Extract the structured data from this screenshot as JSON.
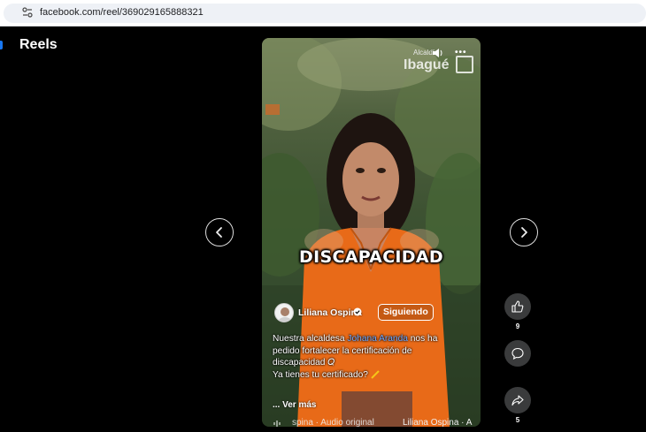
{
  "browser": {
    "url": "facebook.com/reel/369029165888321"
  },
  "page": {
    "title": "Reels"
  },
  "video": {
    "logo_small": "Alcaldía",
    "logo_big": "Ibagué",
    "overlay_text": "DISCAPACIDAD"
  },
  "author": {
    "name": "Liliana Ospina",
    "follow_label": "Siguiendo"
  },
  "caption": {
    "part1": "Nuestra alcaldesa ",
    "mention": "Johana Aranda",
    "part2": " nos ha pedido fortalecer la certificación de discapacidad 𝑄",
    "line2": "Ya tienes tu certificado?",
    "more": "... Ver más"
  },
  "audio": {
    "label": "spina · Audio original",
    "label2": "Liliana Ospina · A"
  },
  "actions": {
    "like_count": "9",
    "share_count": "5"
  },
  "colors": {
    "accent": "#1877f2",
    "shirt": "#e86a18",
    "mention": "#6ea8ff"
  }
}
